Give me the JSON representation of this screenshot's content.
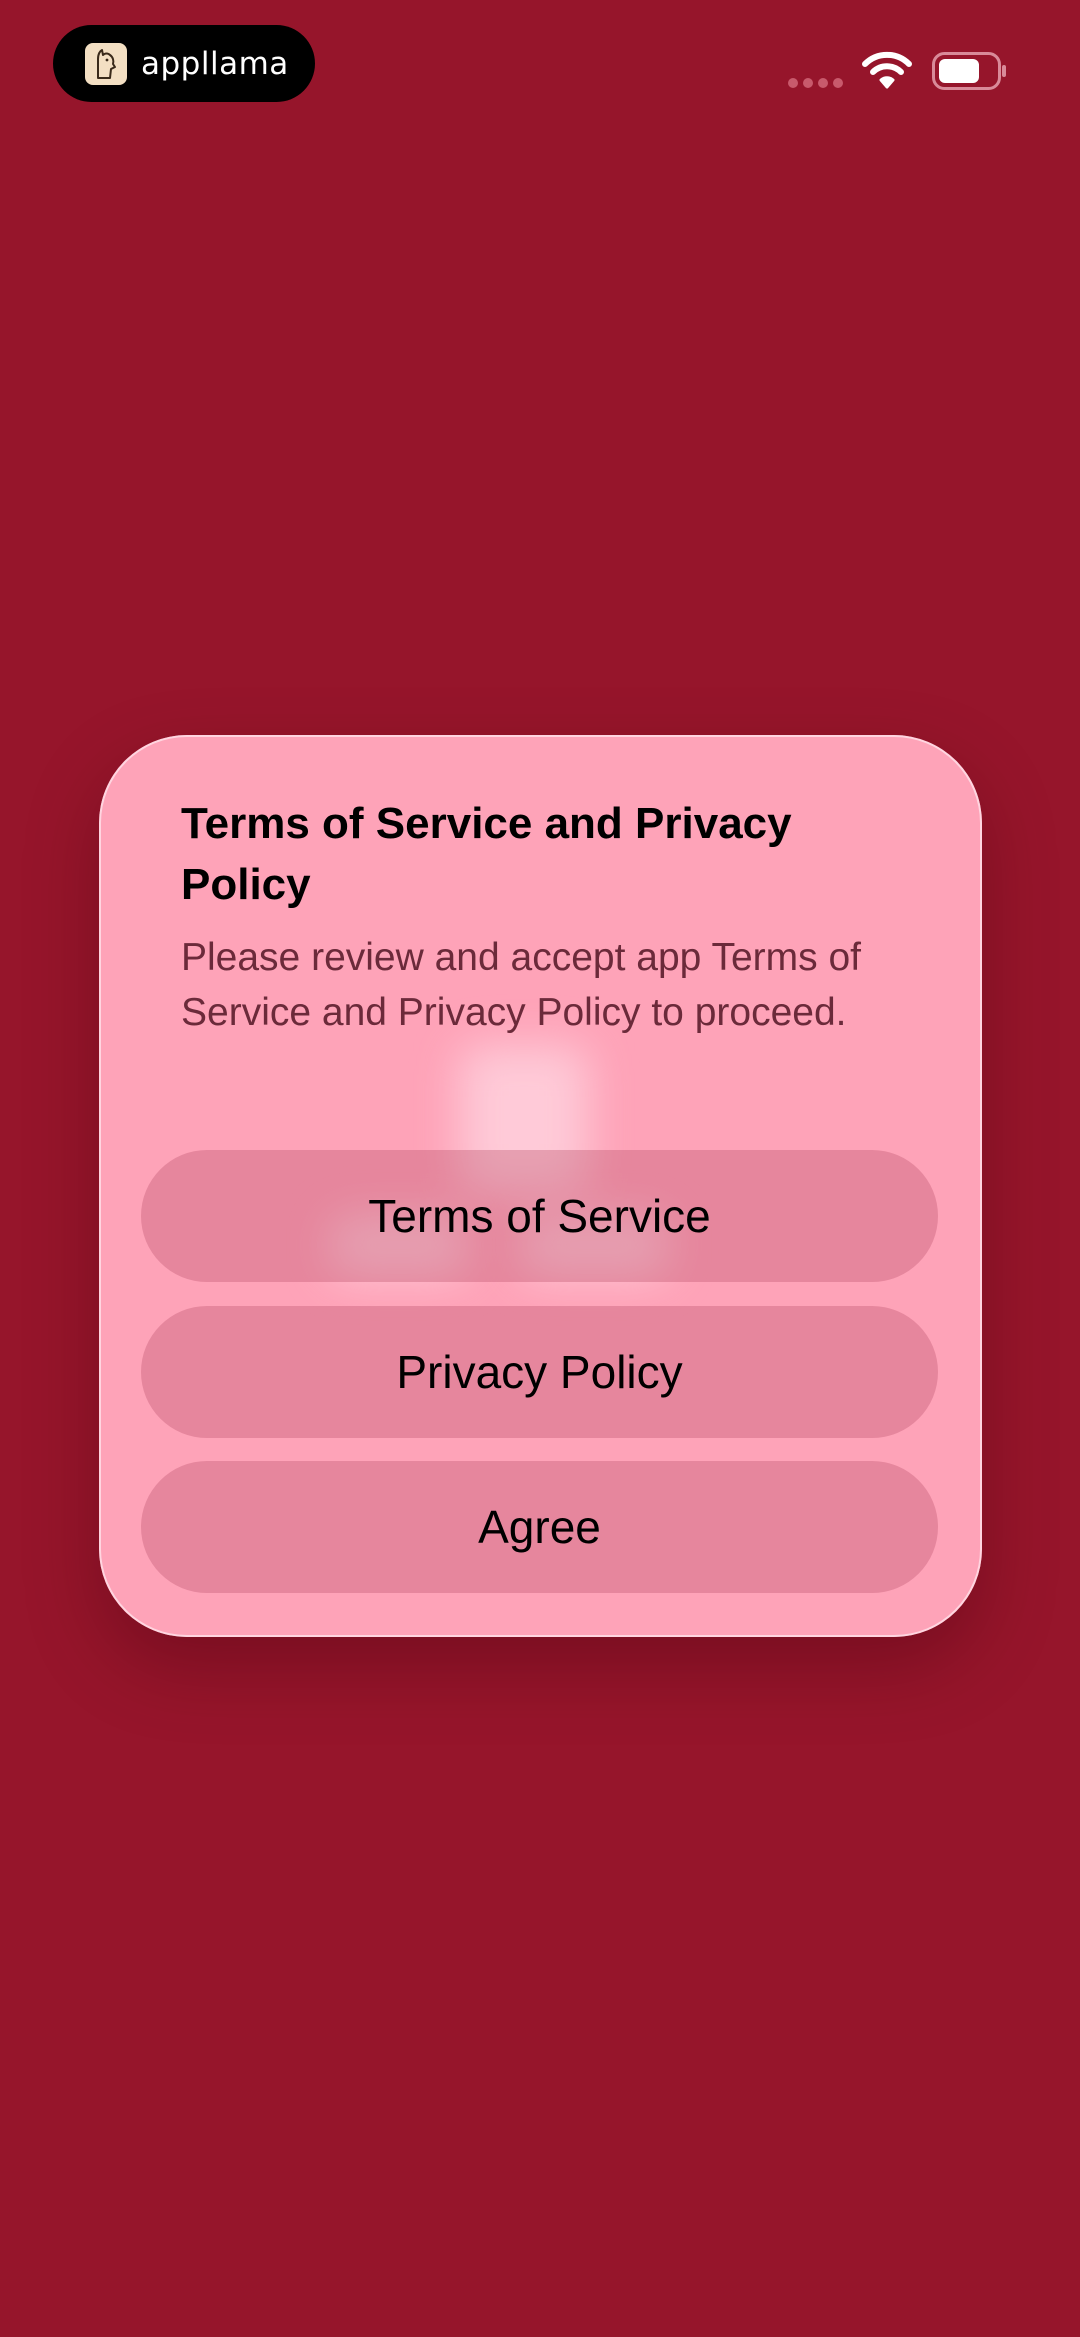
{
  "status_bar": {
    "brand_name": "appllama",
    "icons": [
      "cellular-signal-icon",
      "wifi-icon",
      "battery-icon"
    ]
  },
  "dialog": {
    "title": "Terms of Service and Privacy Policy",
    "message": "Please review and accept app Terms of Service and Privacy Policy to proceed.",
    "buttons": {
      "terms_label": "Terms of Service",
      "privacy_label": "Privacy Policy",
      "agree_label": "Agree"
    }
  },
  "colors": {
    "background": "#96152b",
    "dialog_background": "#fea3b8",
    "button_background": "#dc8398",
    "title_text": "#000000",
    "message_text": "#6b2a3a"
  }
}
